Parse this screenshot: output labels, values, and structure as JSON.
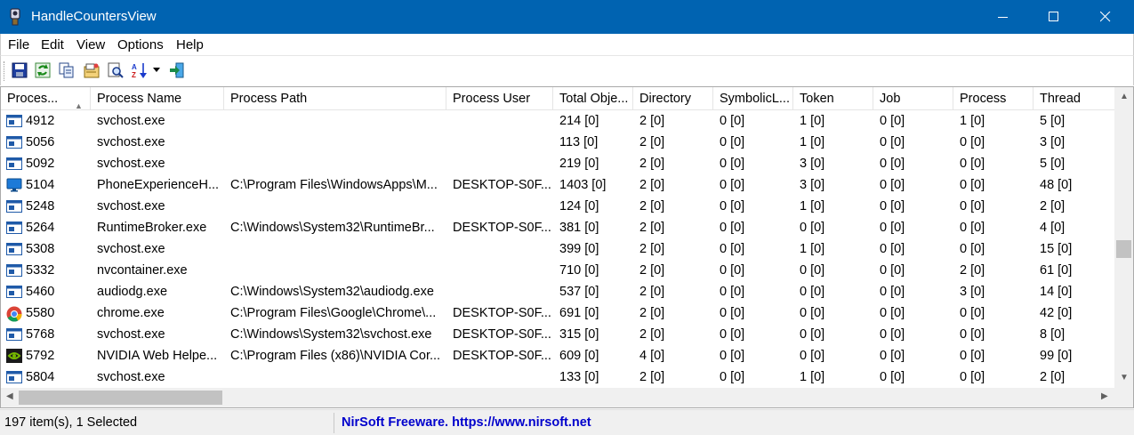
{
  "window": {
    "title": "HandleCountersView",
    "minimize_icon": "minimize-icon",
    "maximize_icon": "maximize-icon",
    "close_icon": "close-icon"
  },
  "menu": [
    "File",
    "Edit",
    "View",
    "Options",
    "Help"
  ],
  "toolbar": {
    "buttons": [
      "save-icon",
      "refresh-icon",
      "copy-icon",
      "properties-icon",
      "find-icon",
      "sort-icon",
      "exit-icon"
    ]
  },
  "columns": [
    "Proces...",
    "Process Name",
    "Process Path",
    "Process User",
    "Total Obje...",
    "Directory",
    "SymbolicL...",
    "Token",
    "Job",
    "Process",
    "Thread"
  ],
  "rows": [
    {
      "icon": "window-icon",
      "cells": [
        "4912",
        "svchost.exe",
        "",
        "",
        "214  [0]",
        "2  [0]",
        "0  [0]",
        "1  [0]",
        "0  [0]",
        "1  [0]",
        "5  [0]"
      ]
    },
    {
      "icon": "window-icon",
      "cells": [
        "5056",
        "svchost.exe",
        "",
        "",
        "113  [0]",
        "2  [0]",
        "0  [0]",
        "1  [0]",
        "0  [0]",
        "0  [0]",
        "3  [0]"
      ]
    },
    {
      "icon": "window-icon",
      "cells": [
        "5092",
        "svchost.exe",
        "",
        "",
        "219  [0]",
        "2  [0]",
        "0  [0]",
        "3  [0]",
        "0  [0]",
        "0  [0]",
        "5  [0]"
      ]
    },
    {
      "icon": "monitor-icon",
      "cells": [
        "5104",
        "PhoneExperienceH...",
        "C:\\Program Files\\WindowsApps\\M...",
        "DESKTOP-S0F...",
        "1403  [0]",
        "2  [0]",
        "0  [0]",
        "3  [0]",
        "0  [0]",
        "0  [0]",
        "48  [0]"
      ]
    },
    {
      "icon": "window-icon",
      "cells": [
        "5248",
        "svchost.exe",
        "",
        "",
        "124  [0]",
        "2  [0]",
        "0  [0]",
        "1  [0]",
        "0  [0]",
        "0  [0]",
        "2  [0]"
      ]
    },
    {
      "icon": "window-icon",
      "cells": [
        "5264",
        "RuntimeBroker.exe",
        "C:\\Windows\\System32\\RuntimeBr...",
        "DESKTOP-S0F...",
        "381  [0]",
        "2  [0]",
        "0  [0]",
        "0  [0]",
        "0  [0]",
        "0  [0]",
        "4  [0]"
      ]
    },
    {
      "icon": "window-icon",
      "cells": [
        "5308",
        "svchost.exe",
        "",
        "",
        "399  [0]",
        "2  [0]",
        "0  [0]",
        "1  [0]",
        "0  [0]",
        "0  [0]",
        "15  [0]"
      ]
    },
    {
      "icon": "window-icon",
      "cells": [
        "5332",
        "nvcontainer.exe",
        "",
        "",
        "710  [0]",
        "2  [0]",
        "0  [0]",
        "0  [0]",
        "0  [0]",
        "2  [0]",
        "61  [0]"
      ]
    },
    {
      "icon": "window-icon",
      "cells": [
        "5460",
        "audiodg.exe",
        "C:\\Windows\\System32\\audiodg.exe",
        "",
        "537  [0]",
        "2  [0]",
        "0  [0]",
        "0  [0]",
        "0  [0]",
        "3  [0]",
        "14  [0]"
      ]
    },
    {
      "icon": "chrome-icon",
      "cells": [
        "5580",
        "chrome.exe",
        "C:\\Program Files\\Google\\Chrome\\...",
        "DESKTOP-S0F...",
        "691  [0]",
        "2  [0]",
        "0  [0]",
        "0  [0]",
        "0  [0]",
        "0  [0]",
        "42  [0]"
      ]
    },
    {
      "icon": "window-icon",
      "cells": [
        "5768",
        "svchost.exe",
        "C:\\Windows\\System32\\svchost.exe",
        "DESKTOP-S0F...",
        "315  [0]",
        "2  [0]",
        "0  [0]",
        "0  [0]",
        "0  [0]",
        "0  [0]",
        "8  [0]"
      ]
    },
    {
      "icon": "nvidia-icon",
      "cells": [
        "5792",
        "NVIDIA Web Helpe...",
        "C:\\Program Files (x86)\\NVIDIA Cor...",
        "DESKTOP-S0F...",
        "609  [0]",
        "4  [0]",
        "0  [0]",
        "0  [0]",
        "0  [0]",
        "0  [0]",
        "99  [0]"
      ]
    },
    {
      "icon": "window-icon",
      "cells": [
        "5804",
        "svchost.exe",
        "",
        "",
        "133  [0]",
        "2  [0]",
        "0  [0]",
        "1  [0]",
        "0  [0]",
        "0  [0]",
        "2  [0]"
      ]
    }
  ],
  "status": {
    "count": "197 item(s), 1 Selected",
    "link": "NirSoft Freeware. https://www.nirsoft.net"
  }
}
